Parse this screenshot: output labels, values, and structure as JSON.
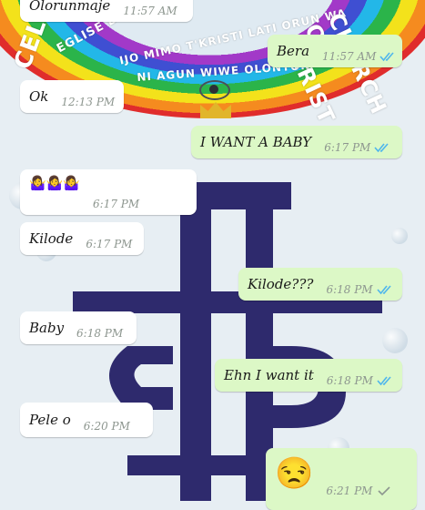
{
  "wallpaper": {
    "arc_words": [
      "CELESTIAL",
      "EGLISE DU CHRISTIANISME CELESTE",
      "IJO MIMO T'KRISTI LATI ORUN WA",
      "NI AGUN WIWE OLONTON",
      "CHURCH OF CHRIST"
    ],
    "colors": {
      "violet": "#a239c8",
      "blue": "#3f4fd2",
      "cyan": "#23b7e8",
      "green": "#2bb44a",
      "yellow": "#f3e21b",
      "orange": "#f58b1f",
      "red": "#e02c2c",
      "emblem": "#2e2a6d"
    }
  },
  "messages": [
    {
      "id": "m1",
      "direction": "in",
      "text": "Olorunmaje",
      "time": "11:57 AM",
      "status": null
    },
    {
      "id": "m2",
      "direction": "out",
      "text": "Bera",
      "time": "11:57 AM",
      "status": "read"
    },
    {
      "id": "m3",
      "direction": "in",
      "text": "Ok",
      "time": "12:13 PM",
      "status": null
    },
    {
      "id": "m4",
      "direction": "out",
      "text": "I WANT A BABY",
      "time": "6:17 PM",
      "status": "read"
    },
    {
      "id": "m5",
      "direction": "in",
      "text": "🤷‍♀️🤷‍♀️🤷‍♀️",
      "time": "6:17 PM",
      "status": null
    },
    {
      "id": "m6",
      "direction": "in",
      "text": "Kilode",
      "time": "6:17 PM",
      "status": null
    },
    {
      "id": "m7",
      "direction": "out",
      "text": "Kilode???",
      "time": "6:18 PM",
      "status": "read"
    },
    {
      "id": "m8",
      "direction": "in",
      "text": "Baby",
      "time": "6:18 PM",
      "status": null
    },
    {
      "id": "m9",
      "direction": "out",
      "text": "Ehn I want it",
      "time": "6:18 PM",
      "status": "read"
    },
    {
      "id": "m10",
      "direction": "in",
      "text": "Pele o",
      "time": "6:20 PM",
      "status": null
    },
    {
      "id": "m11",
      "direction": "out",
      "text": "😒",
      "time": "6:21 PM",
      "status": "delivered"
    }
  ],
  "colors": {
    "incoming_bubble": "#ffffff",
    "outgoing_bubble": "#dcf8c6",
    "read_tick": "#4fb6ec",
    "delivered_tick": "#8d968f"
  }
}
